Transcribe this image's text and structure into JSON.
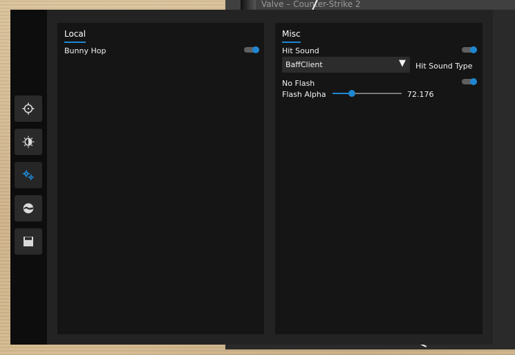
{
  "background": {
    "window_title": "Valve – Counter-Strike 2"
  },
  "sidebar": {
    "tabs": [
      {
        "icon": "crosshair-icon",
        "active": false
      },
      {
        "icon": "brightness-icon",
        "active": false
      },
      {
        "icon": "gears-icon",
        "active": true
      },
      {
        "icon": "globe-icon",
        "active": false
      },
      {
        "icon": "save-icon",
        "active": false
      }
    ]
  },
  "panels": {
    "local": {
      "title": "Local",
      "options": [
        {
          "label": "Bunny Hop",
          "enabled": true
        }
      ]
    },
    "misc": {
      "title": "Misc",
      "hit_sound": {
        "label": "Hit Sound",
        "enabled": true
      },
      "hit_sound_type": {
        "value": "BaffClient",
        "label": "Hit Sound Type"
      },
      "no_flash": {
        "label": "No Flash",
        "enabled": true
      },
      "flash_alpha": {
        "label": "Flash Alpha",
        "value_text": "72.176",
        "value": 72.176,
        "min": 0,
        "max": 255
      }
    }
  },
  "colors": {
    "accent": "#1f86d1"
  }
}
